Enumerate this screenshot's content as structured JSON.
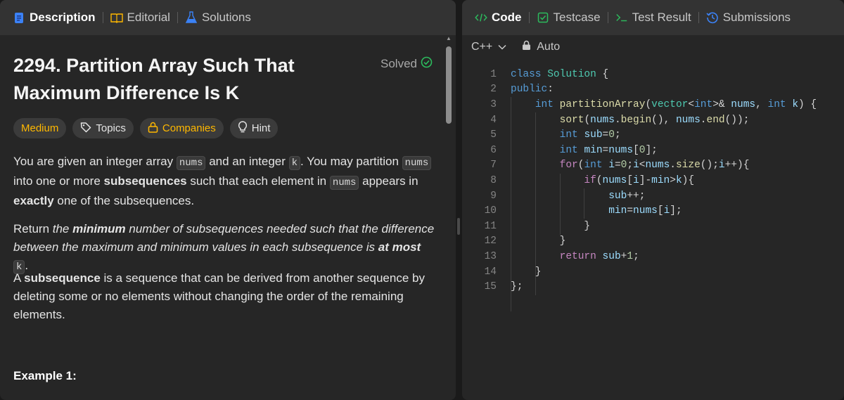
{
  "left_tabs": [
    {
      "label": "Description",
      "icon": "document-icon",
      "active": true
    },
    {
      "label": "Editorial",
      "icon": "book-icon",
      "active": false
    },
    {
      "label": "Solutions",
      "icon": "flask-icon",
      "active": false
    }
  ],
  "problem": {
    "title": "2294. Partition Array Such That Maximum Difference Is K",
    "status": "Solved",
    "chips": {
      "difficulty": "Medium",
      "topics": "Topics",
      "companies": "Companies",
      "hint": "Hint"
    },
    "para1": {
      "t1": "You are given an integer array ",
      "c1": "nums",
      "t2": " and an integer ",
      "c2": "k",
      "t3": ". You may partition ",
      "c3": "nums",
      "t4": " into one or more ",
      "b1": "subsequences",
      "t5": " such that each element in ",
      "c4": "nums",
      "t6": " appears in ",
      "b2": "exactly",
      "t7": " one of the subsequences."
    },
    "para2": {
      "t1": "Return ",
      "i1": "the ",
      "bi1": "minimum",
      "i2": " number of subsequences needed such that the difference between the maximum and minimum values in each subsequence is ",
      "bi2": "at most",
      "c1": "k",
      "t2": "."
    },
    "para3": {
      "t1": "A ",
      "b1": "subsequence",
      "t2": " is a sequence that can be derived from another sequence by deleting some or no elements without changing the order of the remaining elements."
    },
    "example_heading": "Example 1:"
  },
  "right_tabs": [
    {
      "label": "Code",
      "icon": "code-icon",
      "active": true
    },
    {
      "label": "Testcase",
      "icon": "checkbox-icon",
      "active": false
    },
    {
      "label": "Test Result",
      "icon": "terminal-icon",
      "active": false
    },
    {
      "label": "Submissions",
      "icon": "history-icon",
      "active": false
    }
  ],
  "editor_toolbar": {
    "language": "C++",
    "mode": "Auto"
  },
  "code_lines": [
    "1",
    "2",
    "3",
    "4",
    "5",
    "6",
    "7",
    "8",
    "9",
    "10",
    "11",
    "12",
    "13",
    "14",
    "15"
  ],
  "code_text": {
    "l1": "class Solution {",
    "l2": "public:",
    "l3": "int partitionArray(vector<int>& nums, int k) {",
    "l4": "sort(nums.begin(), nums.end());",
    "l5": "int sub=0;",
    "l6": "int min=nums[0];",
    "l7": "for(int i=0;i<nums.size();i++){",
    "l8": "if(nums[i]-min>k){",
    "l9": "sub++;",
    "l10": "min=nums[i];",
    "l11": "}",
    "l12": "}",
    "l13": "return sub+1;",
    "l14": "}",
    "l15": "};"
  },
  "colors": {
    "accent_blue": "#569cd6",
    "difficulty_medium": "#ffb800",
    "solved_green": "#2cbb5d",
    "code_tab_green": "#2cbb5d"
  }
}
